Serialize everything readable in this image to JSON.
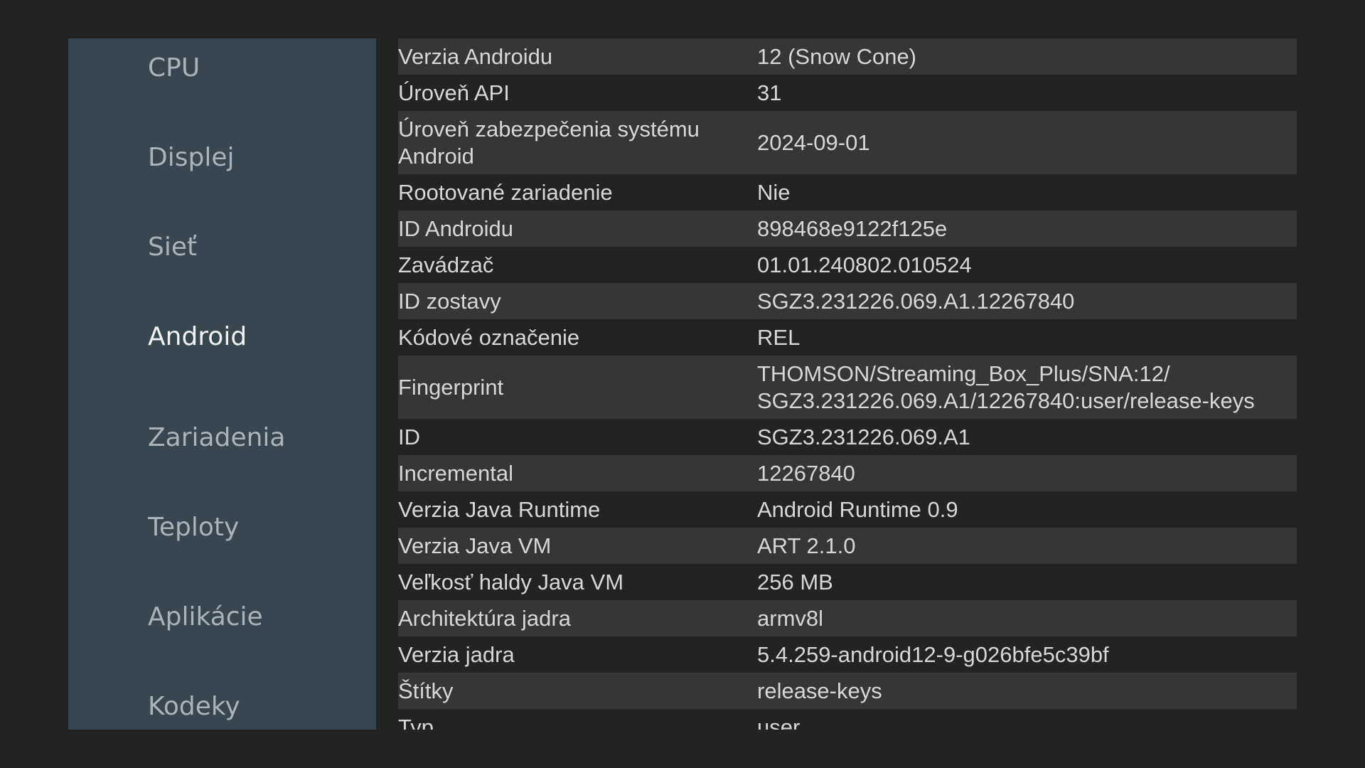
{
  "sidebar": {
    "items": [
      {
        "label": "CPU"
      },
      {
        "label": "Displej"
      },
      {
        "label": "Sieť"
      },
      {
        "label": "Android"
      },
      {
        "label": "Zariadenia"
      },
      {
        "label": "Teploty"
      },
      {
        "label": "Aplikácie"
      },
      {
        "label": "Kodeky"
      }
    ],
    "active": "Android"
  },
  "info": {
    "rows": [
      {
        "label": "Verzia Androidu",
        "value": "12 (Snow Cone)"
      },
      {
        "label": "Úroveň API",
        "value": "31"
      },
      {
        "label": "Úroveň zabezpečenia systému Android",
        "value": "2024-09-01"
      },
      {
        "label": "Rootované zariadenie",
        "value": "Nie"
      },
      {
        "label": "ID Androidu",
        "value": "898468e9122f125e"
      },
      {
        "label": "Zavádzač",
        "value": "01.01.240802.010524"
      },
      {
        "label": "ID zostavy",
        "value": "SGZ3.231226.069.A1.12267840"
      },
      {
        "label": "Kódové označenie",
        "value": "REL"
      },
      {
        "label": "Fingerprint",
        "value": "THOMSON/Streaming_Box_Plus/SNA:12/ SGZ3.231226.069.A1/12267840:user/release-keys"
      },
      {
        "label": "ID",
        "value": "SGZ3.231226.069.A1"
      },
      {
        "label": "Incremental",
        "value": "12267840"
      },
      {
        "label": "Verzia Java Runtime",
        "value": "Android Runtime 0.9"
      },
      {
        "label": "Verzia Java VM",
        "value": "ART 2.1.0"
      },
      {
        "label": "Veľkosť haldy Java VM",
        "value": "256 MB"
      },
      {
        "label": "Architektúra jadra",
        "value": "armv8l"
      },
      {
        "label": "Verzia jadra",
        "value": "5.4.259-android12-9-g026bfe5c39bf"
      },
      {
        "label": "Štítky",
        "value": "release-keys"
      },
      {
        "label": "Typ",
        "value": "user"
      }
    ]
  },
  "colors": {
    "background": "#232323",
    "sidebar": "#37474f",
    "row_stripe": "#363636",
    "text": "#d7d7d7",
    "nav_inactive": "#a9b4b9",
    "nav_active": "#f2f2f2"
  }
}
